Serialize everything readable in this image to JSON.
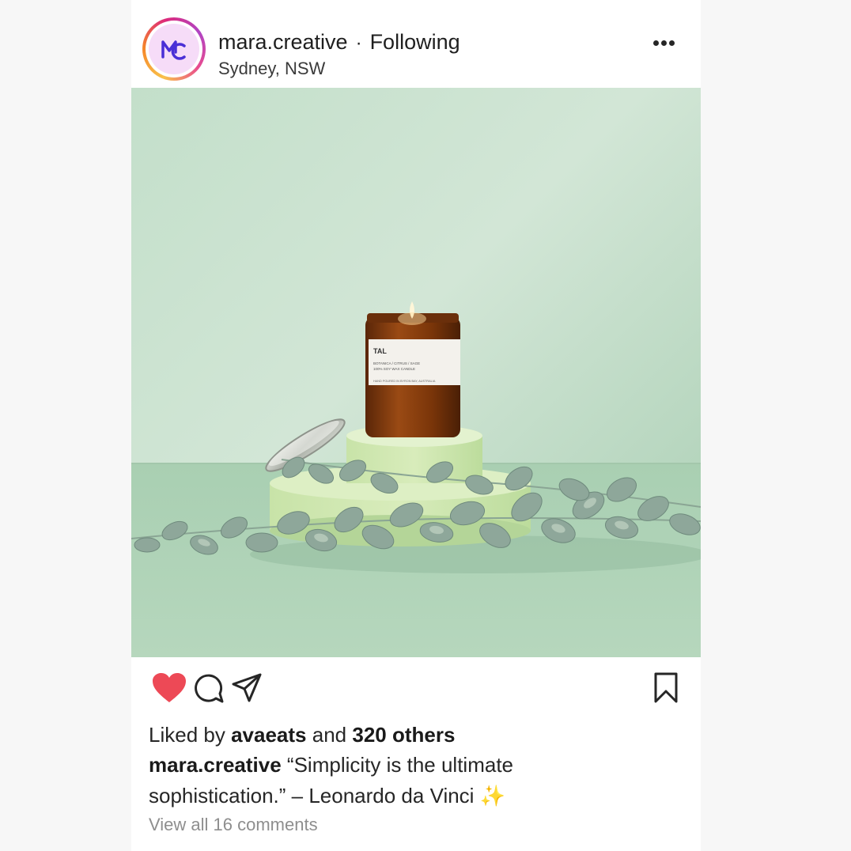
{
  "post": {
    "username": "mara.creative",
    "separator": "·",
    "follow_status": "Following",
    "location": "Sydney, NSW",
    "avatar_initials": "MC",
    "photo": {
      "jar_label_title": "TAL",
      "jar_label_line1": "BOTANICA / CITRUS / SAGE",
      "jar_label_line2": "100% SOY WAX CANDLE",
      "jar_label_line3": "HAND POURED IN BYRON BAY, AUSTRALIA"
    },
    "likes": {
      "prefix": "Liked by",
      "liker": "avaeats",
      "conjunction": "and",
      "others": "320 others"
    },
    "caption": {
      "author": "mara.creative",
      "text": "“Simplicity is the ultimate sophistication.” – Leonardo da Vinci ✨"
    },
    "view_comments": "View all 16 comments"
  },
  "icons": {
    "more": "more-options-icon",
    "like": "heart-icon",
    "comment": "comment-icon",
    "share": "send-icon",
    "save": "bookmark-icon"
  },
  "colors": {
    "heart": "#ed4956",
    "background": "#f7f7f7",
    "photo_bg": "#b9d9c0",
    "muted_text": "#8e8e8e"
  }
}
